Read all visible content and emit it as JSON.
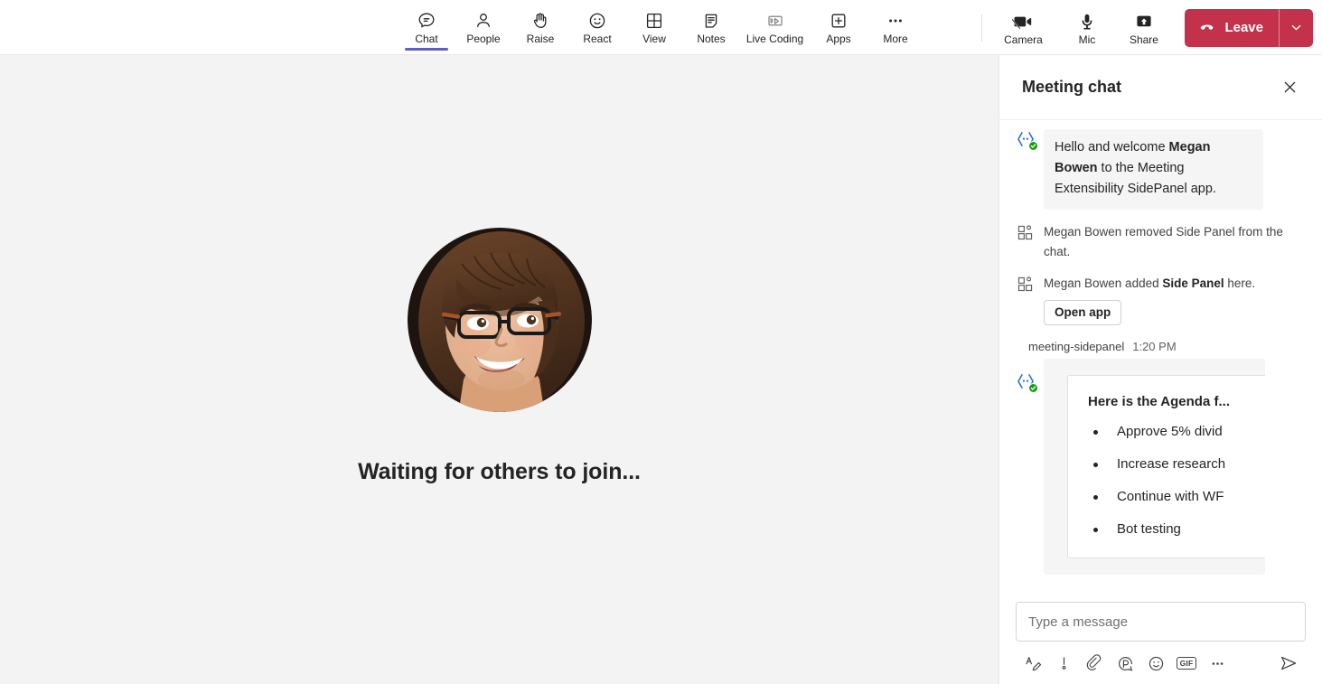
{
  "toolbar": {
    "items": [
      {
        "label": "Chat",
        "icon": "chat-icon",
        "active": true
      },
      {
        "label": "People",
        "icon": "people-icon",
        "active": false
      },
      {
        "label": "Raise",
        "icon": "raise-hand-icon",
        "active": false
      },
      {
        "label": "React",
        "icon": "react-icon",
        "active": false
      },
      {
        "label": "View",
        "icon": "view-grid-icon",
        "active": false
      },
      {
        "label": "Notes",
        "icon": "notes-icon",
        "active": false
      },
      {
        "label": "Live Coding",
        "icon": "live-coding-icon",
        "active": false
      },
      {
        "label": "Apps",
        "icon": "apps-plus-icon",
        "active": false
      },
      {
        "label": "More",
        "icon": "more-icon",
        "active": false
      }
    ],
    "right_items": [
      {
        "label": "Camera",
        "icon": "camera-off-icon"
      },
      {
        "label": "Mic",
        "icon": "mic-icon"
      },
      {
        "label": "Share",
        "icon": "share-icon"
      }
    ],
    "leave": {
      "label": "Leave",
      "icon": "hangup-icon",
      "caret_icon": "chevron-down-icon",
      "color": "#c4314b"
    },
    "active_indicator_color": "#5b5fc7"
  },
  "stage": {
    "waiting_text": "Waiting for others to join...",
    "avatar_name": "avatar",
    "background_color": "#f3f3f3"
  },
  "chat": {
    "title": "Meeting chat",
    "close_icon": "close-icon",
    "messages": [
      {
        "type": "bot_bubble",
        "avatar_icon": "bot-avatar-icon",
        "parts": [
          {
            "text": "Hello and welcome ",
            "bold": false
          },
          {
            "text": "Megan Bowen",
            "bold": true
          },
          {
            "text": " to the Meeting Extensibility SidePanel app.",
            "bold": false
          }
        ]
      },
      {
        "type": "system",
        "icon": "apps-grid-icon",
        "parts": [
          {
            "text": "Megan Bowen removed Side Panel from the chat.",
            "bold": false
          }
        ]
      },
      {
        "type": "system",
        "icon": "apps-grid-icon",
        "parts": [
          {
            "text": "Megan Bowen added ",
            "bold": false
          },
          {
            "text": "Side Panel",
            "bold": true
          },
          {
            "text": " here.",
            "bold": false
          }
        ],
        "button": "Open app"
      },
      {
        "type": "card",
        "sender": "meeting-sidepanel",
        "timestamp": "1:20 PM",
        "avatar_icon": "bot-avatar-icon",
        "card": {
          "title": "Here is the Agenda f...",
          "items": [
            "Approve 5% divid",
            "Increase research",
            "Continue with WF",
            "Bot testing"
          ]
        }
      }
    ],
    "compose": {
      "placeholder": "Type a message",
      "value": "",
      "tools": [
        {
          "name": "format-icon",
          "glyph": "A"
        },
        {
          "name": "priority-icon",
          "glyph": "!"
        },
        {
          "name": "attach-icon",
          "glyph": "paperclip"
        },
        {
          "name": "loop-icon",
          "glyph": "P"
        },
        {
          "name": "emoji-icon",
          "glyph": "smiley"
        },
        {
          "name": "gif-icon",
          "glyph": "GIF"
        },
        {
          "name": "more-icon",
          "glyph": "..."
        }
      ],
      "send_icon": "send-icon"
    }
  }
}
